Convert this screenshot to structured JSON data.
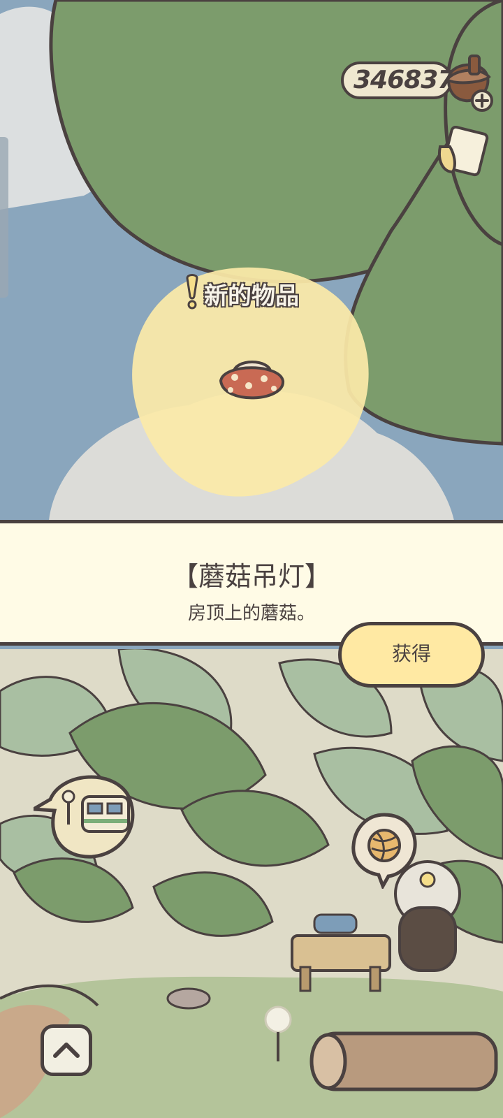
{
  "hud": {
    "acorn_count": "346837",
    "acorn_icon": "acorn-icon",
    "add_icon": "plus-icon",
    "notes_icon": "notes-icon"
  },
  "marker": {
    "label": "新的物品"
  },
  "item": {
    "name": "【蘑菇吊灯】",
    "description": "房顶上的蘑菇。",
    "icon": "mushroom-lamp-icon"
  },
  "actions": {
    "get_label": "获得"
  },
  "scene": {
    "train_icon": "train-station-icon",
    "yarn_icon": "yarn-ball-icon",
    "up_icon": "chevron-up-icon"
  },
  "colors": {
    "leaf": "#7c9c6c",
    "sky": "#8aa6bd",
    "highlight": "#fbe9a8",
    "panel": "#fffbe6",
    "outline": "#4a4140",
    "button": "#ffe9a3"
  }
}
